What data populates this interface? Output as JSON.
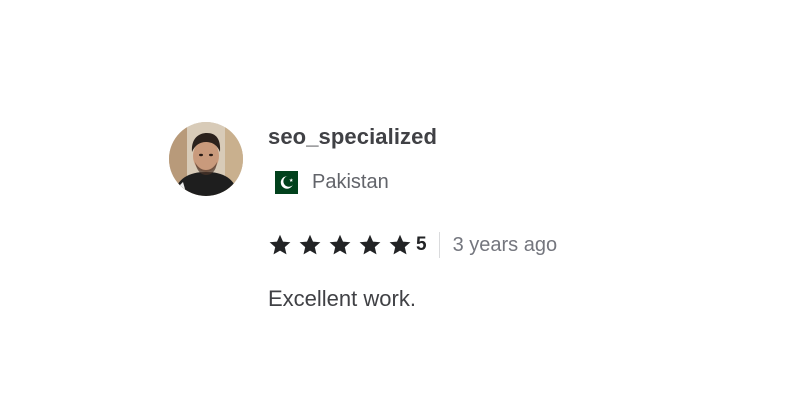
{
  "review": {
    "username": "seo_specialized",
    "avatar_icon": "user-avatar-photo",
    "country": {
      "flag_icon": "pakistan-flag-icon",
      "name": "Pakistan"
    },
    "rating": {
      "value": "5",
      "stars_filled": 5,
      "stars_total": 5,
      "star_color": "#222325"
    },
    "time_ago": "3 years ago",
    "text": "Excellent work."
  },
  "colors": {
    "primary_text": "#404145",
    "secondary_text": "#62646a",
    "muted_text": "#74767e",
    "divider": "#dadbdd",
    "flag_green": "#01411c"
  }
}
